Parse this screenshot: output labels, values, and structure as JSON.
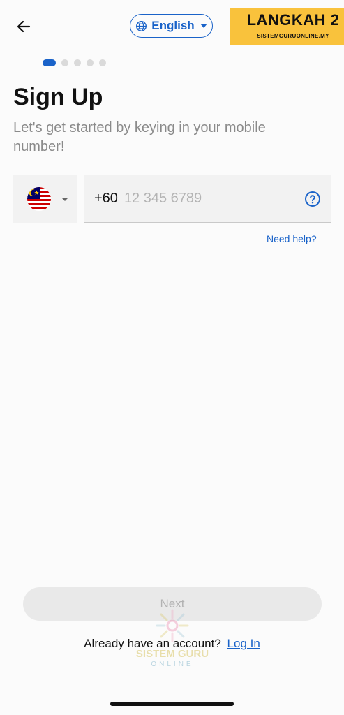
{
  "header": {
    "language_label": "English"
  },
  "banner": {
    "title": "LANGKAH 2",
    "subtitle": "SISTEMGURUONLINE.MY"
  },
  "progress": {
    "total_steps": 5,
    "current_step": 1
  },
  "page": {
    "title": "Sign Up",
    "subtitle": "Let's get started by keying in your mobile number!"
  },
  "phone": {
    "country_flag": "malaysia-flag",
    "dial_code": "+60",
    "placeholder": "12 345 6789",
    "value": "",
    "need_help": "Need help?"
  },
  "footer": {
    "next_label": "Next",
    "account_prompt": "Already have an account?",
    "login_label": "Log In"
  },
  "watermark": {
    "text": "SISTEM GURU",
    "sub": "ONLINE"
  },
  "colors": {
    "accent": "#1a63c9",
    "banner": "#f9c23c",
    "disabled_button": "#e9e9e9"
  }
}
